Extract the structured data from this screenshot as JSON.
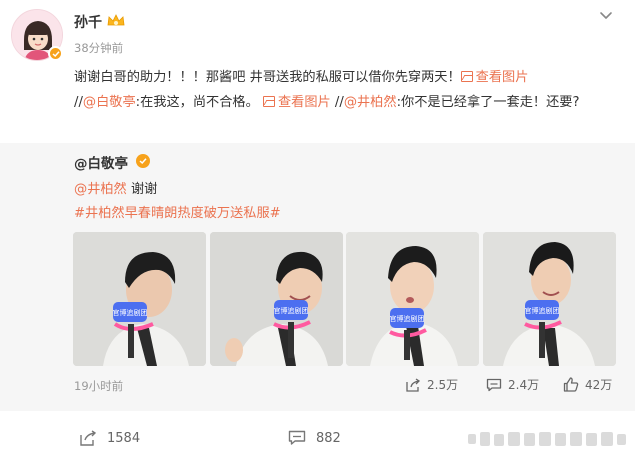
{
  "post": {
    "author": "孙千",
    "time": "38分钟前",
    "text_segments": [
      {
        "type": "text",
        "value": "谢谢白哥的助力！！！那酱吧 井哥送我的私服可以借你先穿两天！"
      },
      {
        "type": "link",
        "value": "查看图片",
        "icon": "image-icon"
      },
      {
        "type": "text",
        "value": " //"
      },
      {
        "type": "link",
        "value": "@白敬亭"
      },
      {
        "type": "text",
        "value": ":在我这，尚不合格。"
      },
      {
        "type": "link",
        "value": "查看图片",
        "icon": "image-icon"
      },
      {
        "type": "text",
        "value": " //"
      },
      {
        "type": "link",
        "value": "@井柏然"
      },
      {
        "type": "text",
        "value": ":你不是已经拿了一套走！还要?"
      }
    ]
  },
  "repost": {
    "author": "@白敬亭",
    "mention": "@井柏然",
    "reply": "谢谢",
    "hashtag": "#井柏然早春晴朗热度破万送私服#",
    "time": "19小时前",
    "reposts": "2.5万",
    "comments": "2.4万",
    "likes": "42万",
    "images": [
      {
        "mic_label": "官博追剧团",
        "pose": "side"
      },
      {
        "mic_label": "官博追剧团",
        "pose": "smile"
      },
      {
        "mic_label": "官博追剧团",
        "pose": "talk"
      },
      {
        "mic_label": "官博追剧团",
        "pose": "front"
      }
    ]
  },
  "footer": {
    "reposts": "1584",
    "comments": "882"
  },
  "colors": {
    "link": "#eb7350",
    "badge": "#f7a21b",
    "repost_bg": "#f6f6f6",
    "muted": "#999999"
  }
}
